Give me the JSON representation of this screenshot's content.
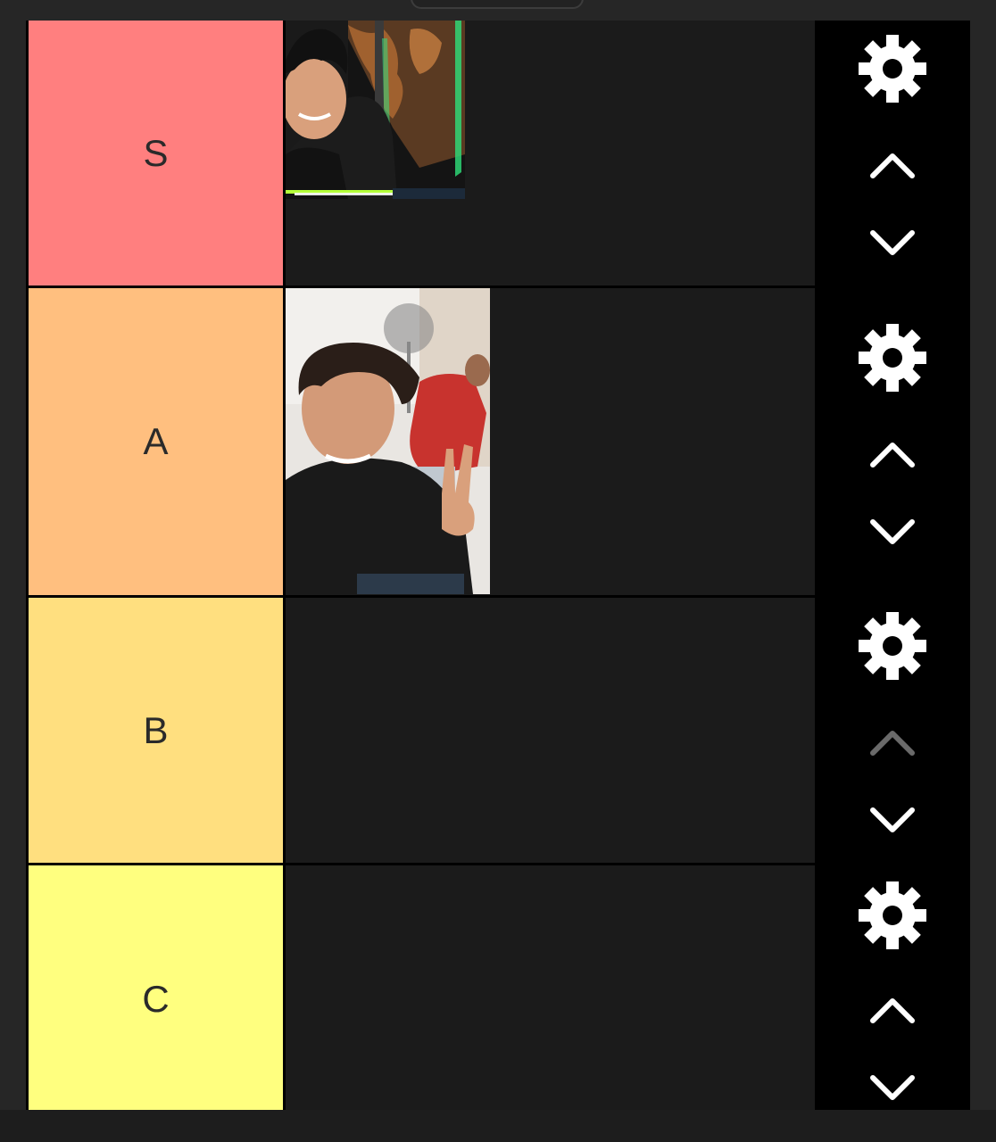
{
  "tiers": [
    {
      "label": "S",
      "color": "#ff7f7f",
      "items": [
        "photo-gamer-room"
      ]
    },
    {
      "label": "A",
      "color": "#ffbf7f",
      "items": [
        "photo-peace-sign"
      ]
    },
    {
      "label": "B",
      "color": "#ffdf7f",
      "items": []
    },
    {
      "label": "C",
      "color": "#ffff7f",
      "items": []
    }
  ],
  "controls": {
    "settings_icon": "gear-icon",
    "move_up_icon": "chevron-up-icon",
    "move_down_icon": "chevron-down-icon"
  }
}
